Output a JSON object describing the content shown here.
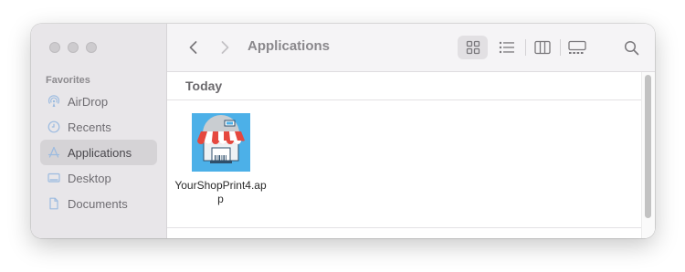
{
  "window": {
    "title": "Applications"
  },
  "sidebar": {
    "heading": "Favorites",
    "items": [
      {
        "label": "AirDrop",
        "icon": "airdrop-icon",
        "active": false
      },
      {
        "label": "Recents",
        "icon": "clock-icon",
        "active": false
      },
      {
        "label": "Applications",
        "icon": "applications-icon",
        "active": true
      },
      {
        "label": "Desktop",
        "icon": "desktop-icon",
        "active": false
      },
      {
        "label": "Documents",
        "icon": "document-icon",
        "active": false
      }
    ]
  },
  "toolbar": {
    "back_icon": "chevron-left-icon",
    "forward_icon": "chevron-right-icon",
    "views": [
      "icon-view-icon",
      "list-view-icon",
      "column-view-icon",
      "gallery-view-icon"
    ],
    "selected_view": "icon-view-icon",
    "search_icon": "search-icon"
  },
  "content": {
    "sections": [
      {
        "heading": "Today",
        "files": [
          {
            "name": "YourShopPrint4.app",
            "icon": "shop-storefront-app-icon"
          }
        ]
      }
    ]
  },
  "colors": {
    "sidebar_bg": "#e8e6e9",
    "toolbar_bg": "#f5f4f6",
    "sidebar_active": "#d5d3d6",
    "sidebar_icon_accent": "#9cbbe0",
    "app_icon_bg": "#4cb0e8",
    "awning_red": "#e5483f"
  }
}
